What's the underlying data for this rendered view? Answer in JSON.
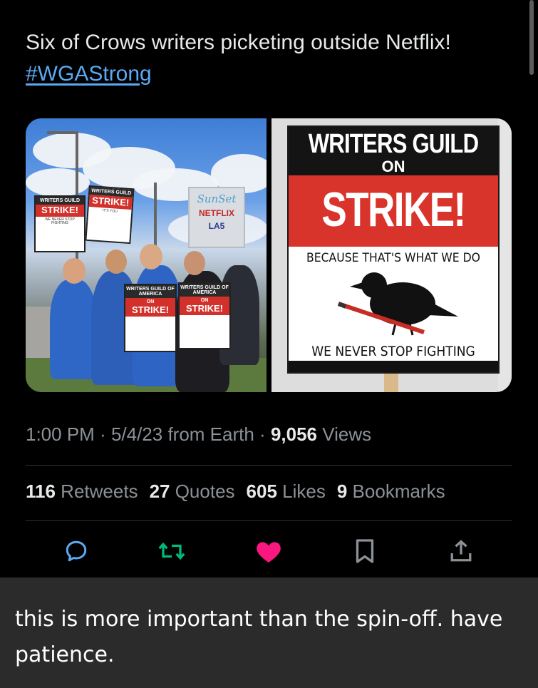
{
  "tweet": {
    "text": "Six of Crows writers picketing outside Netflix!",
    "hashtag": "#WGAStrong",
    "media": {
      "left_photo": {
        "sunset_sign": {
          "logo": "SunSet",
          "netflix": "NETFLIX",
          "la": "LA5"
        },
        "signs": [
          {
            "top": "WRITERS GUILD",
            "strike": "STRIKE!",
            "foot": "WE NEVER STOP FIGHTING"
          },
          {
            "top": "WRITERS GUILD",
            "strike": "STRIKE!",
            "foot": "IT'S YOU"
          },
          {
            "top": "WRITERS GUILD OF AMERICA",
            "on": "ON",
            "strike": "STRIKE!"
          },
          {
            "top": "WRITERS GUILD OF AMERICA",
            "on": "ON",
            "strike": "STRIKE!"
          }
        ]
      },
      "right_photo": {
        "title": "WRITERS GUILD",
        "on": "ON",
        "strike": "STRIKE!",
        "because": "BECAUSE THAT'S WHAT WE DO",
        "never": "WE NEVER STOP FIGHTING"
      }
    },
    "meta": {
      "time": "1:00 PM",
      "sep1": " · ",
      "date": "5/4/23",
      "source": " from Earth",
      "sep2": " · ",
      "views_count": "9,056",
      "views_label": " Views"
    },
    "stats": [
      {
        "count": "116",
        "label": " Retweets"
      },
      {
        "count": "27",
        "label": " Quotes"
      },
      {
        "count": "605",
        "label": " Likes"
      },
      {
        "count": "9",
        "label": " Bookmarks"
      }
    ],
    "actions": {
      "reply_icon": "reply-icon",
      "retweet_icon": "retweet-icon",
      "like_icon": "heart-icon",
      "bookmark_icon": "bookmark-icon",
      "share_icon": "share-icon"
    },
    "colors": {
      "hashtag": "#5aa9f3",
      "retweet": "#00ba7c",
      "like": "#f91880",
      "icon": "#8b9196",
      "comment_bg": "#2b2b2b"
    }
  },
  "comment": {
    "text": "this is more important than the spin-off. have patience."
  }
}
